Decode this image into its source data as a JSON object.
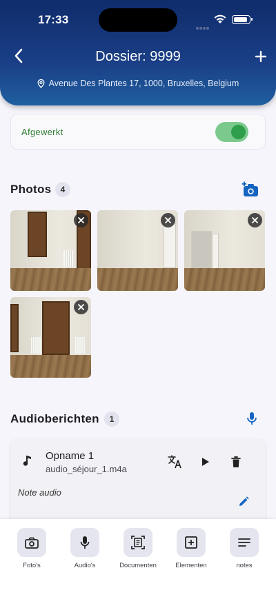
{
  "status_bar": {
    "time": "17:33"
  },
  "header": {
    "title": "Dossier: 9999",
    "address": "Avenue Des Plantes 17, 1000, Bruxelles, Belgium"
  },
  "completion": {
    "label": "Afgewerkt",
    "enabled": true
  },
  "photos": {
    "title": "Photos",
    "count": "4",
    "items": [
      {
        "alt": "room-photo-1"
      },
      {
        "alt": "room-photo-2"
      },
      {
        "alt": "room-photo-3"
      },
      {
        "alt": "room-photo-4"
      }
    ]
  },
  "audio": {
    "title": "Audioberichten",
    "count": "1",
    "items": [
      {
        "name": "Opname 1",
        "file": "audio_séjour_1.m4a",
        "note": "Note audio"
      }
    ]
  },
  "bottom_nav": {
    "items": [
      {
        "label": "Foto's",
        "icon": "camera-icon"
      },
      {
        "label": "Audio's",
        "icon": "mic-icon"
      },
      {
        "label": "Documenten",
        "icon": "document-scan-icon"
      },
      {
        "label": "Elementen",
        "icon": "add-box-icon"
      },
      {
        "label": "notes",
        "icon": "notes-icon"
      }
    ]
  },
  "colors": {
    "header_dark": "#0f2c6b",
    "accent_blue": "#1565c0",
    "success_green": "#2e7d32",
    "background": "#f6f5fb"
  }
}
